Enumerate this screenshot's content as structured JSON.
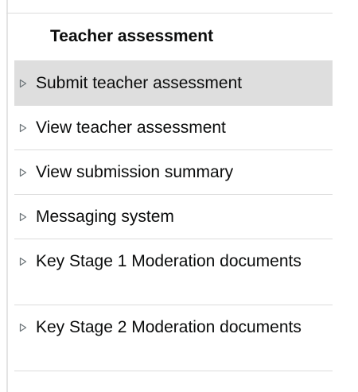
{
  "nav": {
    "heading": "Teacher assessment",
    "items": [
      {
        "label": "Submit teacher assessment",
        "active": true
      },
      {
        "label": "View teacher assessment",
        "active": false
      },
      {
        "label": "View submission summary",
        "active": false
      },
      {
        "label": "Messaging system",
        "active": false
      },
      {
        "label": "Key Stage 1 Moderation documents",
        "active": false
      },
      {
        "label": "Key Stage 2 Moderation documents",
        "active": false
      }
    ]
  },
  "colors": {
    "active_background": "#dedede",
    "divider": "#dcdcdc",
    "text": "#0b0c0c",
    "arrow": "#6f777b"
  },
  "icons": {
    "item_marker": "triangle-right-outline-icon"
  }
}
